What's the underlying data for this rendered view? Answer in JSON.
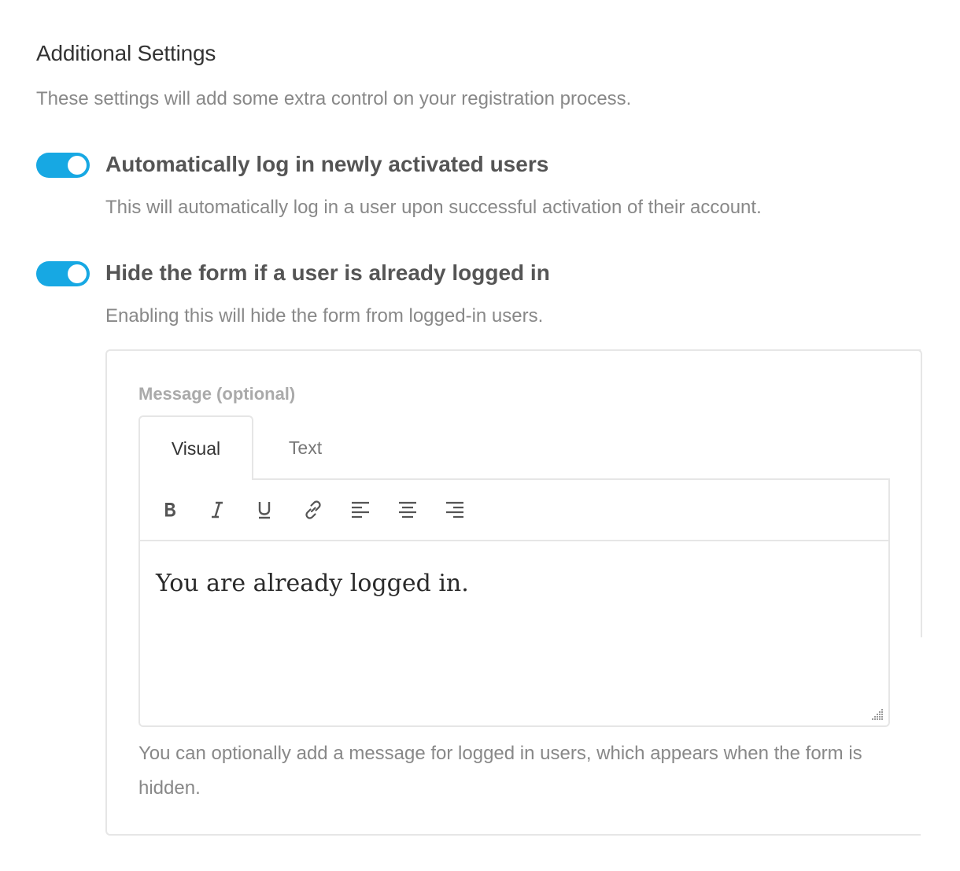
{
  "section": {
    "title": "Additional Settings",
    "description": "These settings will add some extra control on your registration process."
  },
  "options": [
    {
      "label": "Automatically log in newly activated users",
      "description": "This will automatically log in a user upon successful activation of their account.",
      "enabled": true
    },
    {
      "label": "Hide the form if a user is already logged in",
      "description": "Enabling this will hide the form from logged-in users.",
      "enabled": true
    }
  ],
  "message": {
    "label": "Message (optional)",
    "tabs": [
      {
        "label": "Visual",
        "active": true
      },
      {
        "label": "Text",
        "active": false
      }
    ],
    "toolbar": [
      "bold-icon",
      "italic-icon",
      "underline-icon",
      "link-icon",
      "align-left-icon",
      "align-center-icon",
      "align-right-icon"
    ],
    "content": "You are already logged in.",
    "help": "You can optionally add a message for logged in users, which appears when the form is hidden."
  },
  "colors": {
    "accent": "#17a8e3",
    "border": "#e6e6e6",
    "muted_text": "#888888"
  }
}
